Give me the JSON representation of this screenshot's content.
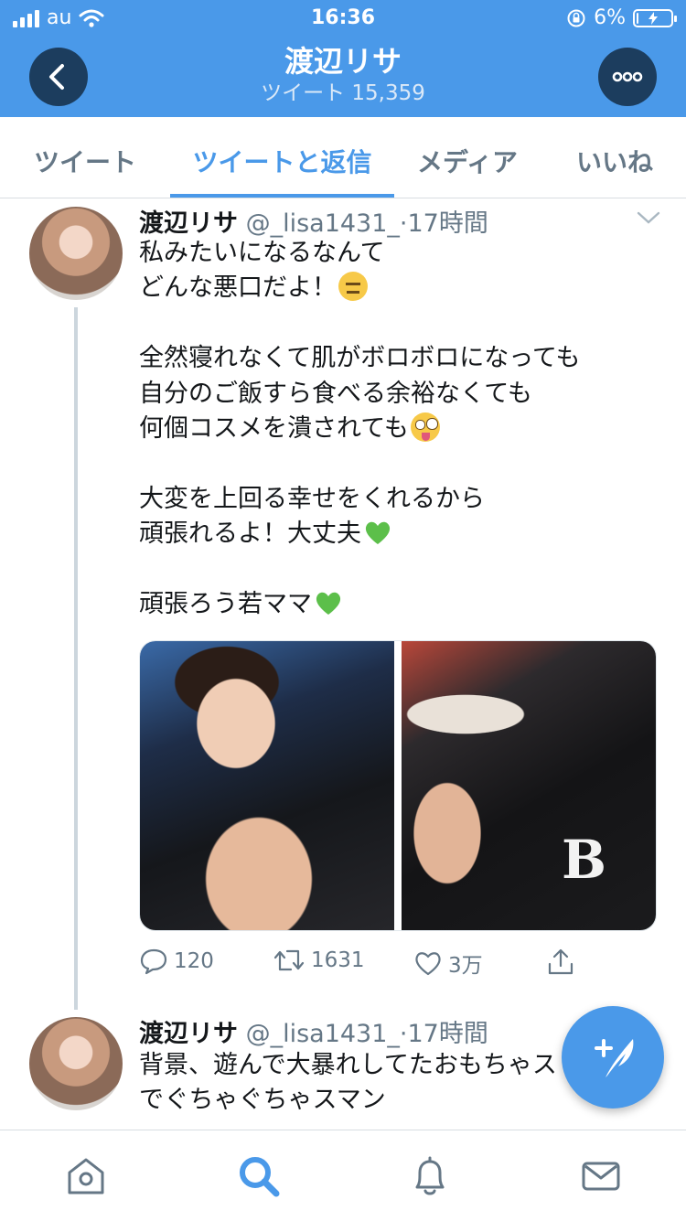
{
  "status_bar": {
    "carrier": "au",
    "time": "16:36",
    "battery": "6%",
    "battery_level": 0.06
  },
  "header": {
    "title": "渡辺リサ",
    "subtitle": "ツイート 15,359",
    "back_icon": "chevron-left-icon",
    "more_icon": "more-dots-icon"
  },
  "tabs": [
    {
      "label": "ツイート",
      "active": false
    },
    {
      "label": "ツイートと返信",
      "active": true
    },
    {
      "label": "メディア",
      "active": false
    },
    {
      "label": "いいね",
      "active": false
    }
  ],
  "tweets": [
    {
      "name": "渡辺リサ",
      "meta": " @_lisa1431_·17時間",
      "lines": [
        "私みたいになるなんて",
        "どんな悪口だよ！",
        "",
        "全然寝れなくて肌がボロボロになっても",
        "自分のご飯すら食べる余裕なくても",
        "何個コスメを潰されても",
        "",
        "大変を上回る幸せをくれるから",
        "頑張れるよ！大丈夫",
        "",
        "頑張ろう若ママ"
      ],
      "photo_text": "B",
      "stats": {
        "replies": "120",
        "retweets": "1631",
        "likes": "3万"
      }
    },
    {
      "name": "渡辺リサ",
      "meta": " @_lisa1431_·17時間",
      "lines": [
        "背景、遊んで大暴れしてたおもちゃス",
        "でぐちゃぐちゃスマン"
      ]
    }
  ],
  "nav": [
    {
      "icon": "home-icon",
      "active": false
    },
    {
      "icon": "search-icon",
      "active": true
    },
    {
      "icon": "notifications-bell-icon",
      "active": false
    },
    {
      "icon": "messages-envelope-icon",
      "active": false
    }
  ],
  "fab": {
    "icon": "compose-tweet-icon"
  },
  "colors": {
    "brand": "#4a99e9",
    "text": "#14171a",
    "muted": "#657786"
  }
}
